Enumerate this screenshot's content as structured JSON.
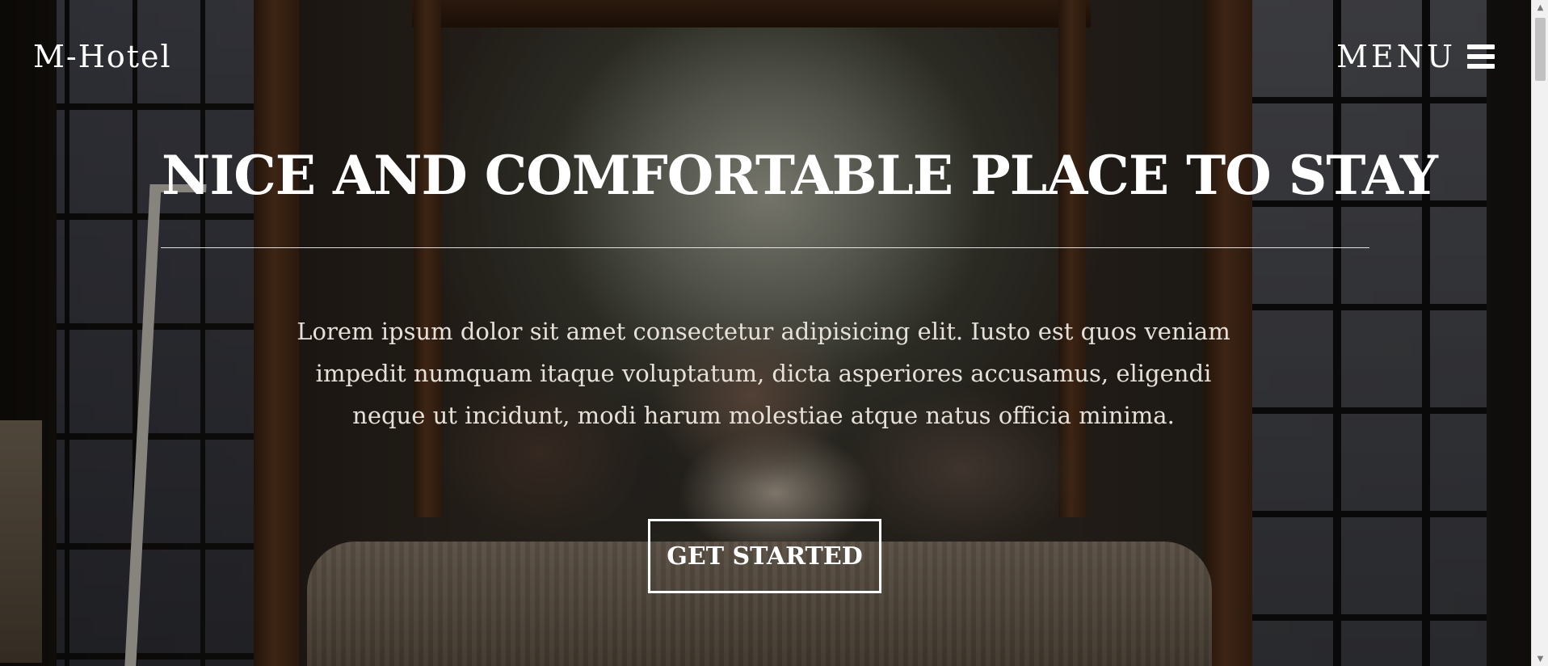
{
  "brand": {
    "logo": "M-Hotel"
  },
  "nav": {
    "menu_label": "MENU",
    "menu_icon": "hamburger-icon"
  },
  "hero": {
    "headline": "NICE AND COMFORTABLE PLACE TO STAY",
    "lead": "Lorem ipsum dolor sit amet consectetur adipisicing elit. Iusto est quos veniam impedit numquam itaque voluptatum, dicta asperiores accusamus, eligendi neque ut incidunt, modi harum molestiae atque natus officia minima.",
    "cta_label": "GET STARTED",
    "background_image": "canopy-bed-room-photo"
  },
  "scrollbar": {
    "up_icon": "scroll-up-arrow-icon",
    "down_icon": "scroll-down-arrow-icon",
    "position_fraction": 0.0
  },
  "colors": {
    "text": "#ffffff",
    "overlay": "#000000",
    "scrollbar_track": "#f1f1f1",
    "scrollbar_thumb": "#c1c1c1"
  }
}
